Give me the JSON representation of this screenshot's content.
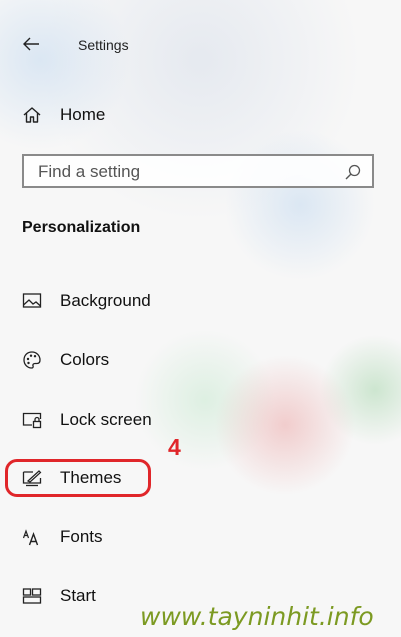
{
  "header": {
    "title": "Settings"
  },
  "home": {
    "label": "Home",
    "icon": "home-icon"
  },
  "search": {
    "placeholder": "Find a setting",
    "value": "",
    "icon": "search-icon"
  },
  "section": {
    "title": "Personalization"
  },
  "menu": {
    "items": [
      {
        "label": "Background",
        "icon": "picture-icon"
      },
      {
        "label": "Colors",
        "icon": "palette-icon"
      },
      {
        "label": "Lock screen",
        "icon": "lock-screen-icon"
      },
      {
        "label": "Themes",
        "icon": "themes-icon"
      },
      {
        "label": "Fonts",
        "icon": "fonts-icon"
      },
      {
        "label": "Start",
        "icon": "start-icon"
      }
    ]
  },
  "annotation": {
    "step_number": "4",
    "highlight_color": "#e0262a"
  },
  "watermark": {
    "text": "www.tayninhit.info",
    "color": "#7c9a22"
  },
  "colors": {
    "text": "#111111",
    "search_border": "#8a8a8a"
  }
}
